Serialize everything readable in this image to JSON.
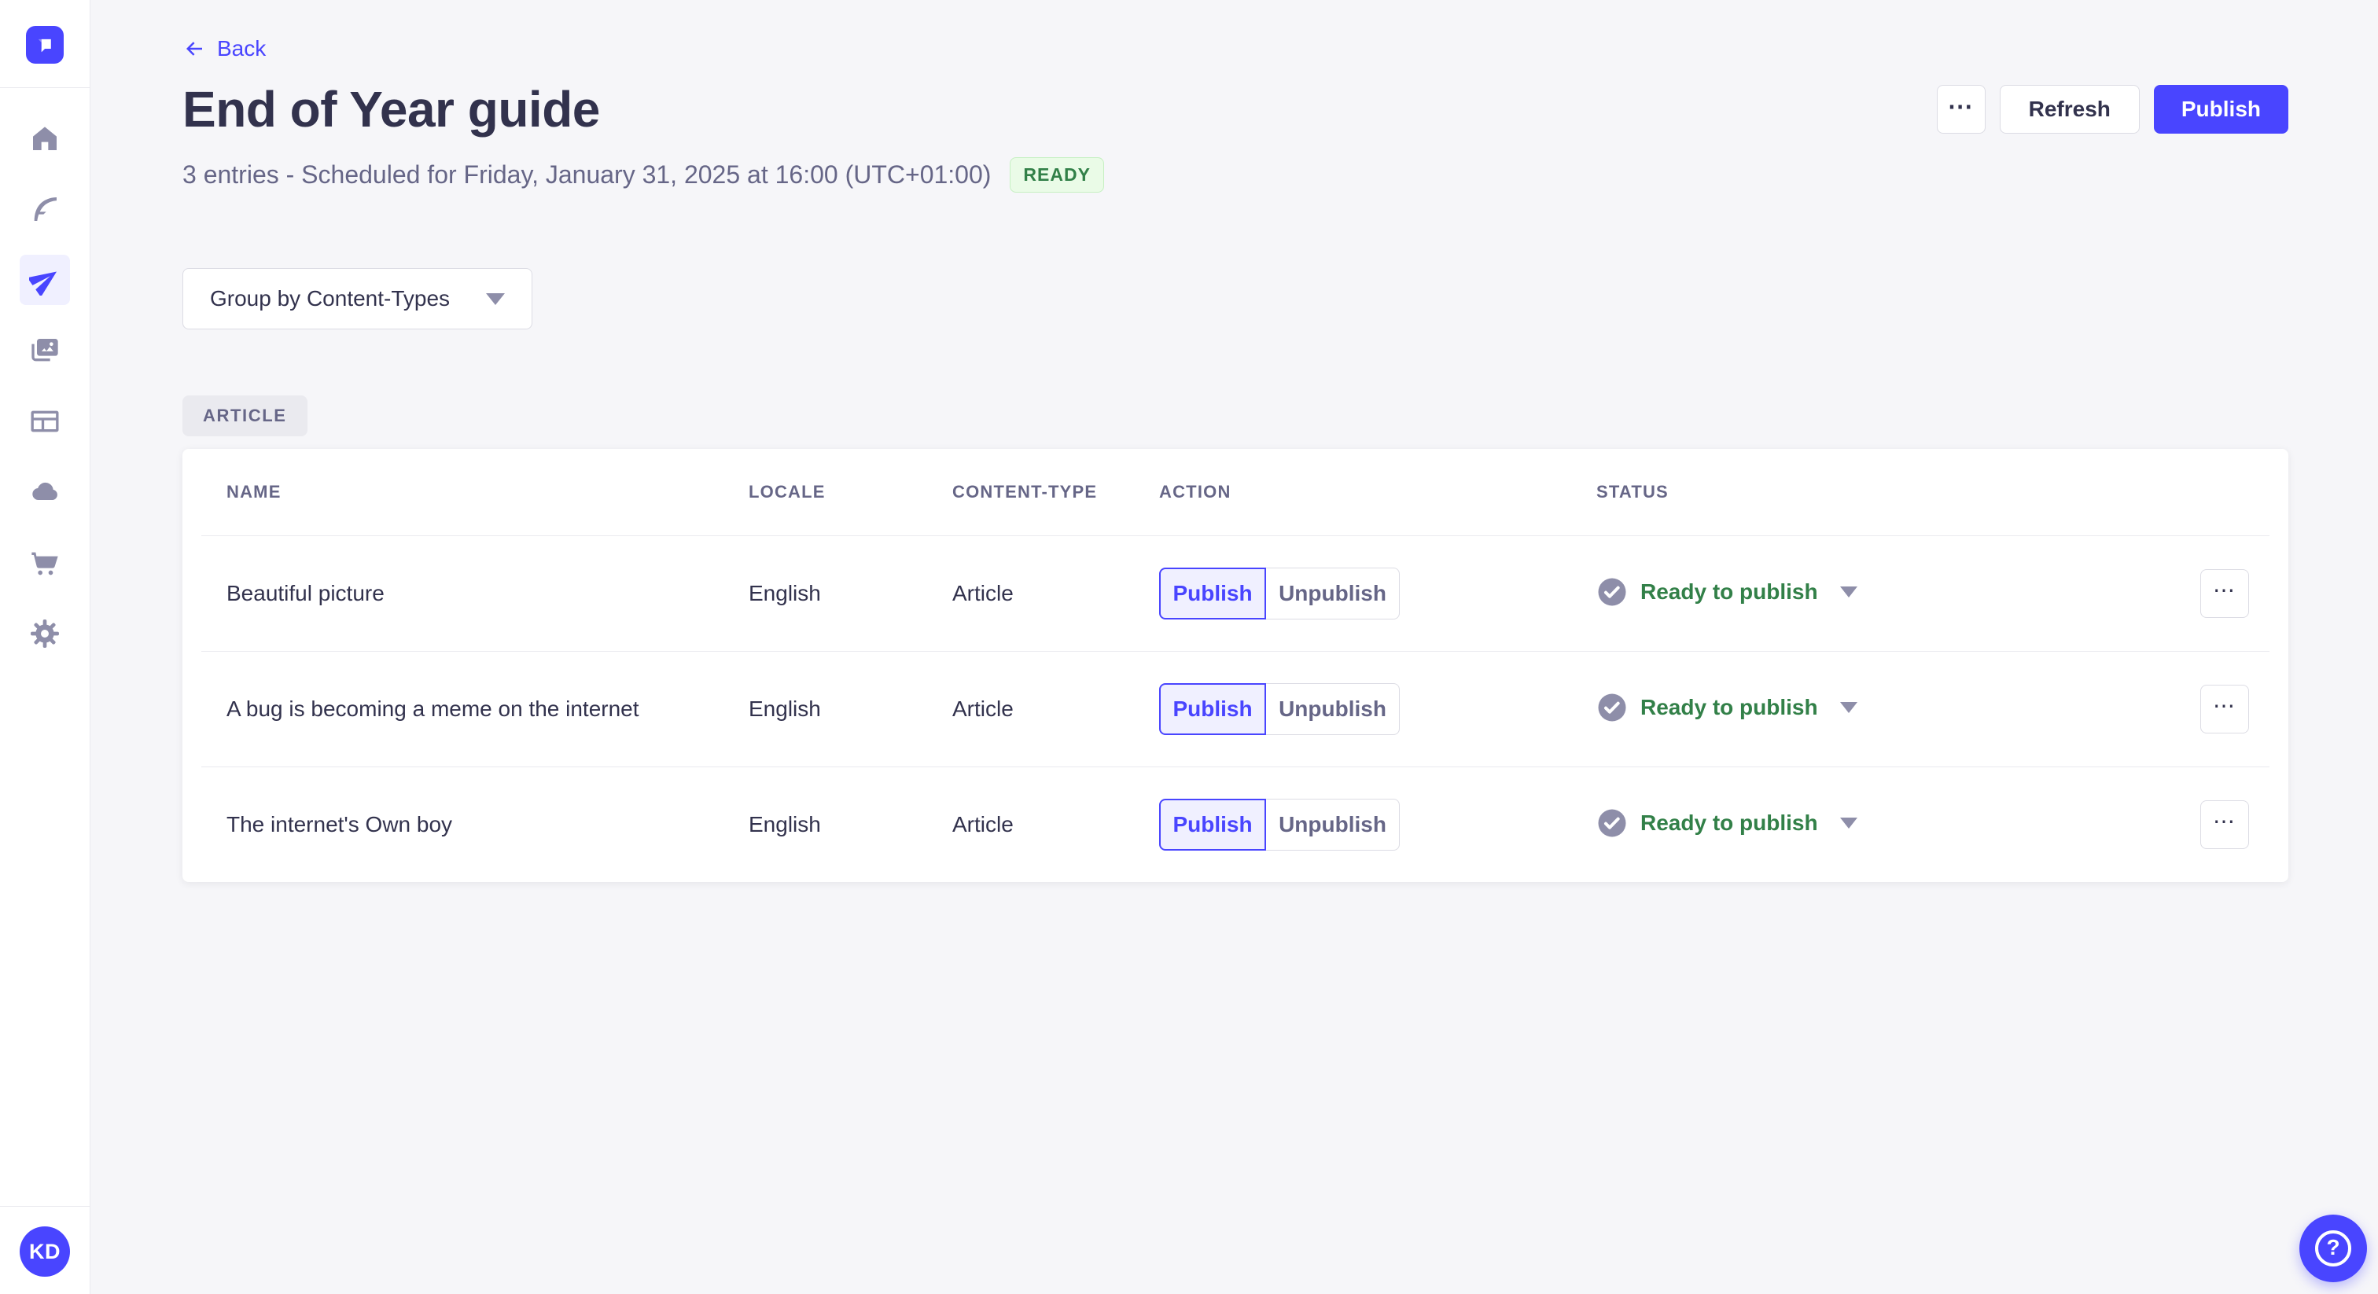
{
  "colors": {
    "primary": "#4945ff",
    "primary_light_bg": "#f0f0ff",
    "page_bg": "#f6f6f9",
    "text_dark": "#32324d",
    "text_muted": "#666687",
    "icon_gray": "#8e8ea9",
    "border": "#dcdce4",
    "divider": "#eaeaef",
    "success_text": "#328048",
    "success_bg": "#eafbe7",
    "success_border": "#c6f0c2"
  },
  "icons": {
    "more": "⋯",
    "help": "?"
  },
  "sidebar": {
    "items": [
      {
        "icon": "home-icon"
      },
      {
        "icon": "feather-icon"
      },
      {
        "icon": "paper-plane-icon",
        "active": true
      },
      {
        "icon": "media-icon"
      },
      {
        "icon": "layout-icon"
      },
      {
        "icon": "cloud-icon"
      },
      {
        "icon": "cart-icon"
      },
      {
        "icon": "gear-icon"
      }
    ],
    "avatar_initials": "KD"
  },
  "header": {
    "back": "Back",
    "title": "End of Year guide",
    "subtitle": "3 entries - Scheduled for Friday, January 31, 2025 at 16:00 (UTC+01:00)",
    "status_badge": "READY",
    "refresh_label": "Refresh",
    "publish_label": "Publish"
  },
  "filters": {
    "group_by_label": "Group by Content-Types"
  },
  "group": {
    "badge": "ARTICLE"
  },
  "table": {
    "columns": [
      "NAME",
      "LOCALE",
      "CONTENT-TYPE",
      "ACTION",
      "STATUS"
    ],
    "rows": [
      {
        "name": "Beautiful picture",
        "locale": "English",
        "content_type": "Article",
        "publish_label": "Publish",
        "unpublish_label": "Unpublish",
        "status": "Ready to publish"
      },
      {
        "name": "A bug is becoming a meme on the internet",
        "locale": "English",
        "content_type": "Article",
        "publish_label": "Publish",
        "unpublish_label": "Unpublish",
        "status": "Ready to publish"
      },
      {
        "name": "The internet's Own boy",
        "locale": "English",
        "content_type": "Article",
        "publish_label": "Publish",
        "unpublish_label": "Unpublish",
        "status": "Ready to publish"
      }
    ]
  }
}
